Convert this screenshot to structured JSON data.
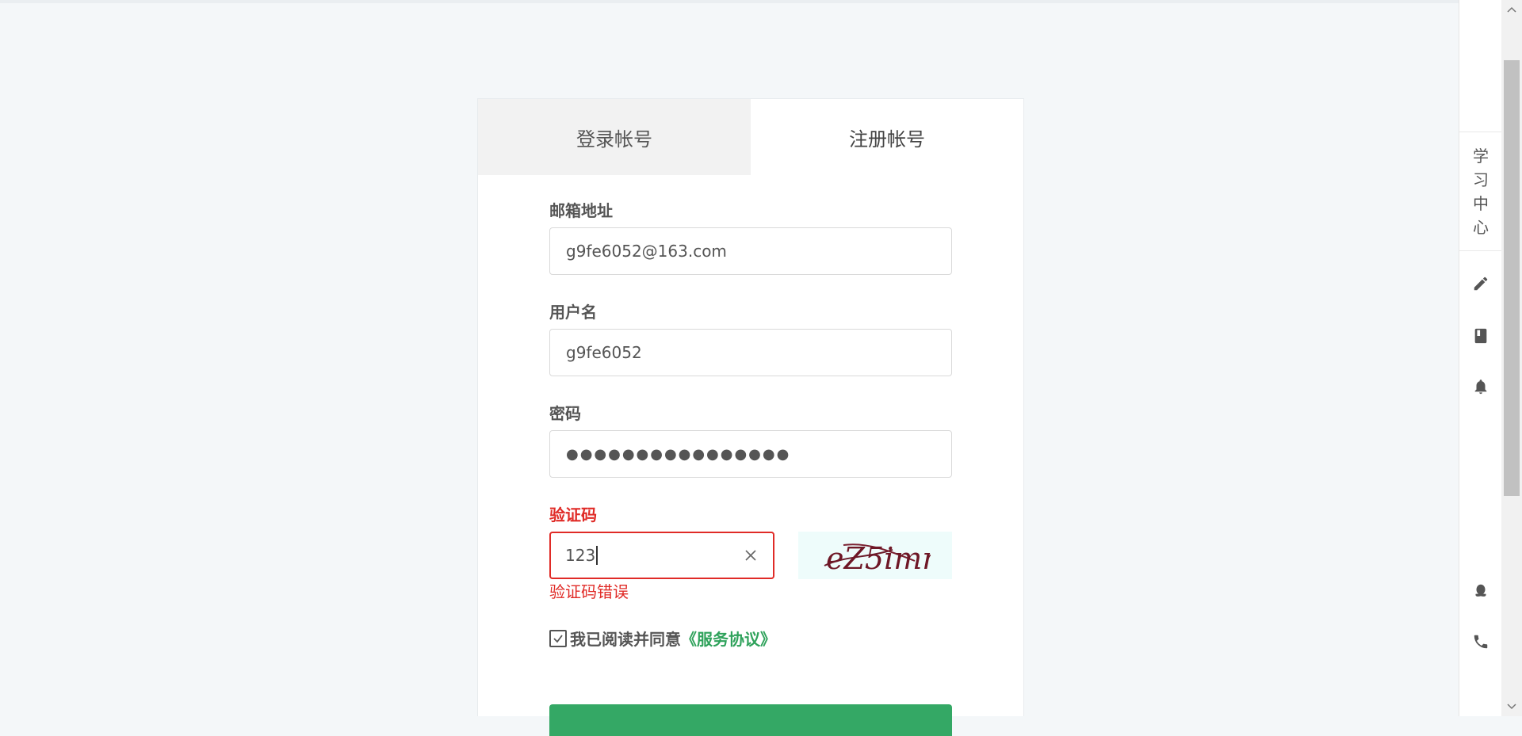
{
  "tabs": [
    {
      "label": "登录帐号",
      "active": false
    },
    {
      "label": "注册帐号",
      "active": true
    }
  ],
  "form": {
    "email": {
      "label": "邮箱地址",
      "value": "g9fe6052@163.com"
    },
    "username": {
      "label": "用户名",
      "value": "g9fe6052"
    },
    "password": {
      "label": "密码",
      "masked": "●●●●●●●●●●●●●●●●"
    },
    "captcha": {
      "label": "验证码",
      "value": "123",
      "error": "验证码错误",
      "image_text": "eZ5imn"
    },
    "agree": {
      "text": "我已阅读并同意",
      "link": "《服务协议》",
      "checked": true
    }
  },
  "rightbar": {
    "learning_center": [
      "学",
      "习",
      "中",
      "心"
    ],
    "icons": [
      "pencil-icon",
      "book-icon",
      "bell-icon",
      "qq-icon",
      "phone-icon"
    ]
  },
  "colors": {
    "error": "#e02b27",
    "accent": "#2fa25b",
    "button": "#34a865"
  }
}
